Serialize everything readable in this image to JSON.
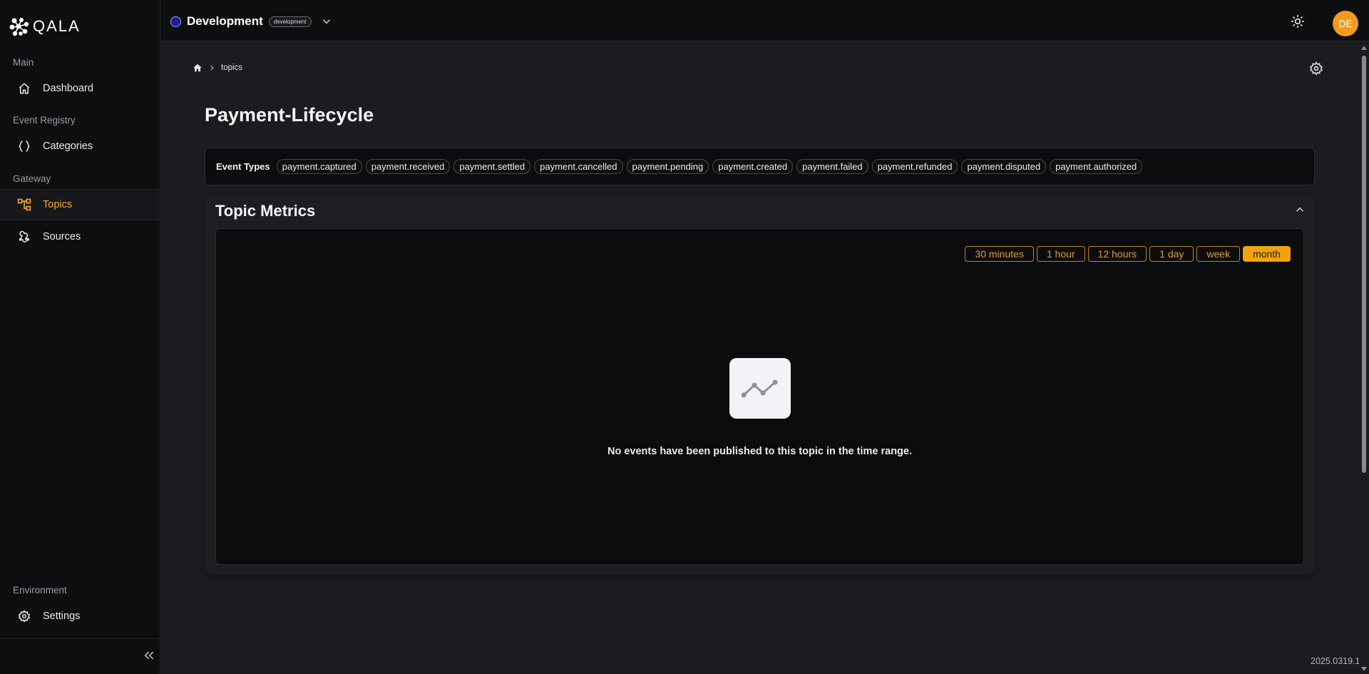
{
  "brand": {
    "logo_text": "QALA"
  },
  "sidebar": {
    "sections": [
      {
        "label": "Main"
      },
      {
        "label": "Event Registry"
      },
      {
        "label": "Gateway"
      },
      {
        "label": "Environment"
      }
    ],
    "items": [
      {
        "label": "Dashboard",
        "icon": "home-icon"
      },
      {
        "label": "Categories",
        "icon": "braces-icon"
      },
      {
        "label": "Topics",
        "icon": "topics-icon",
        "active": true
      },
      {
        "label": "Sources",
        "icon": "webhook-icon"
      },
      {
        "label": "Settings",
        "icon": "gear-icon"
      }
    ]
  },
  "topbar": {
    "environment": "Development",
    "environment_badge": "development",
    "avatar_initials": "DE"
  },
  "breadcrumb": {
    "current": "topics"
  },
  "page": {
    "title": "Payment-Lifecycle"
  },
  "event_types": {
    "label": "Event Types",
    "chips": [
      "payment.captured",
      "payment.received",
      "payment.settled",
      "payment.cancelled",
      "payment.pending",
      "payment.created",
      "payment.failed",
      "payment.refunded",
      "payment.disputed",
      "payment.authorized"
    ]
  },
  "metrics": {
    "title": "Topic Metrics",
    "ranges": [
      "30 minutes",
      "1 hour",
      "12 hours",
      "1 day",
      "week",
      "month"
    ],
    "selected_range": "month",
    "empty_message": "No events have been published to this topic in the time range."
  },
  "version": "2025.0319.1",
  "colors": {
    "accent": "#f3a530",
    "avatar": "#f39a1c",
    "range_active": "#efa40f"
  }
}
